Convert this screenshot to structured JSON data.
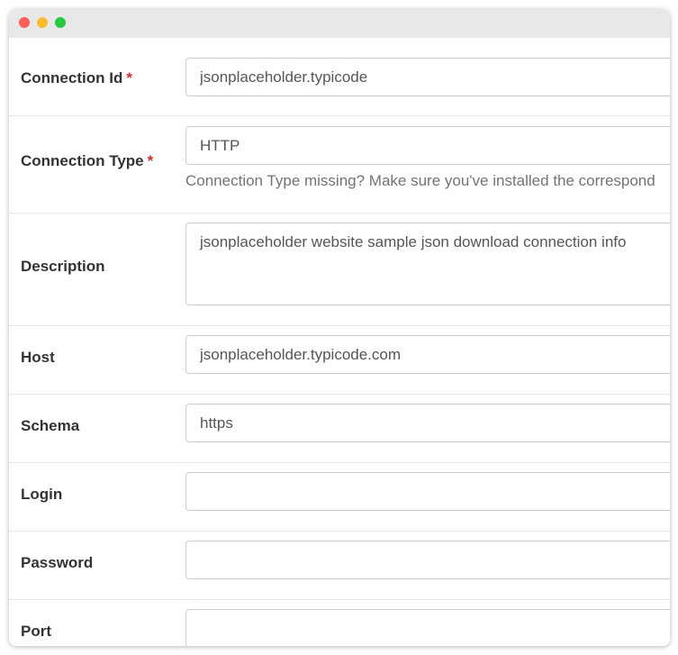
{
  "window": {
    "traffic_lights": [
      "close",
      "minimize",
      "zoom"
    ],
    "colors": {
      "close": "#ff5f57",
      "minimize": "#febc2e",
      "zoom": "#28c840"
    }
  },
  "required_marker": "*",
  "fields": {
    "connection_id": {
      "label": "Connection Id",
      "required": true,
      "value": "jsonplaceholder.typicode"
    },
    "connection_type": {
      "label": "Connection Type",
      "required": true,
      "value": "HTTP",
      "help": "Connection Type missing? Make sure you've installed the correspond"
    },
    "description": {
      "label": "Description",
      "value": "jsonplaceholder website sample json download connection info"
    },
    "host": {
      "label": "Host",
      "value": "jsonplaceholder.typicode.com"
    },
    "schema": {
      "label": "Schema",
      "value": "https"
    },
    "login": {
      "label": "Login",
      "value": ""
    },
    "password": {
      "label": "Password",
      "value": ""
    },
    "port": {
      "label": "Port",
      "value": ""
    }
  }
}
